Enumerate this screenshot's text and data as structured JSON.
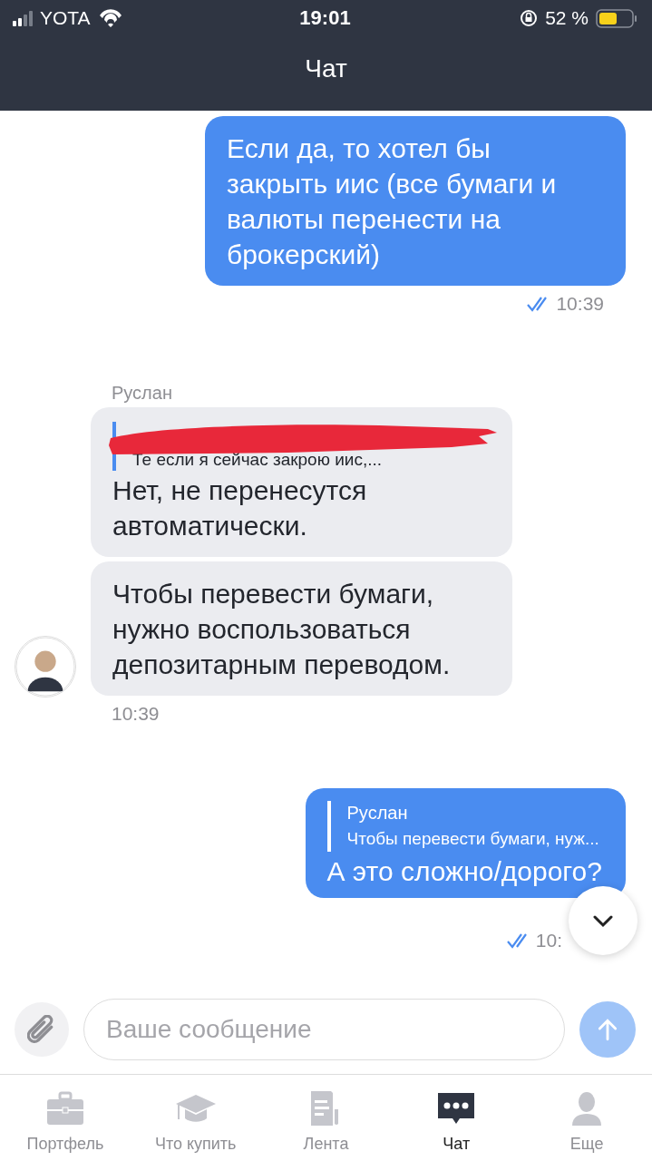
{
  "status_bar": {
    "carrier": "YOTA",
    "time": "19:01",
    "battery": "52 %"
  },
  "header": {
    "title": "Чат"
  },
  "messages": [
    {
      "kind": "outgoing",
      "bubbles": [
        {
          "text": "Если да, то хотел бы закрыть иис (все бумаги и валюты перенести на брокерский)"
        }
      ],
      "time": "10:39",
      "read": true
    },
    {
      "kind": "incoming",
      "sender": "Руслан",
      "bubbles": [
        {
          "quote": {
            "author_redacted": true,
            "text": "Те если я сейчас закрою иис,..."
          },
          "text": "Нет, не перенесутся автоматически."
        },
        {
          "text": "Чтобы перевести бумаги, нужно воспользоваться депозитарным переводом."
        }
      ],
      "time": "10:39"
    },
    {
      "kind": "outgoing",
      "bubbles": [
        {
          "quote": {
            "author": "Руслан",
            "text": "Чтобы перевести бумаги, нуж..."
          },
          "text": "А это сложно/дорого?"
        }
      ],
      "time": "10:",
      "read": true
    }
  ],
  "composer": {
    "placeholder": "Ваше сообщение"
  },
  "tabs": [
    {
      "label": "Портфель",
      "selected": false
    },
    {
      "label": "Что купить",
      "selected": false
    },
    {
      "label": "Лента",
      "selected": false
    },
    {
      "label": "Чат",
      "selected": true
    },
    {
      "label": "Еще",
      "selected": false
    }
  ]
}
